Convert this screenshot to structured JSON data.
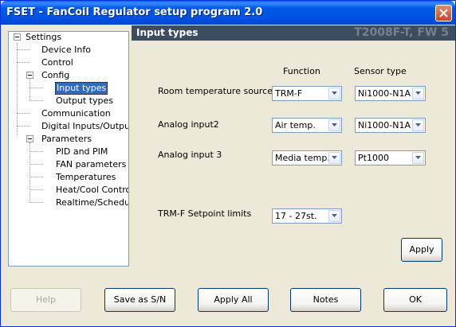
{
  "window": {
    "title": "FSET - FanCoil Regulator setup program 2.0"
  },
  "tree": {
    "items": [
      "Settings",
      "Device Info",
      "Control",
      "Config",
      "Input types",
      "Output types",
      "Communication",
      "Digital Inputs/Outputs",
      "Parameters",
      "PID and PIM",
      "FAN parameters",
      "Temperatures",
      "Heat/Cool Control",
      "Realtime/Schedule"
    ]
  },
  "panel": {
    "title": "Input types",
    "device": "T2008F-T, FW 5",
    "col_function": "Function",
    "col_sensor": "Sensor type",
    "rows": [
      {
        "label": "Room temperature source",
        "function": "TRM-F",
        "sensor": "Ni1000-N1A"
      },
      {
        "label": "Analog input2",
        "function": "Air temp.",
        "sensor": "Ni1000-N1A"
      },
      {
        "label": "Analog input 3",
        "function": "Media temp.",
        "sensor": "Pt1000"
      }
    ],
    "setpoint_label": "TRM-F Setpoint limits",
    "setpoint_value": "17 - 27st.",
    "apply_label": "Apply"
  },
  "footer": {
    "help": "Help",
    "save": "Save as S/N",
    "apply_all": "Apply All",
    "notes": "Notes",
    "ok": "OK"
  },
  "colors": {
    "titlebar": "#0058e6",
    "header": "#3d4c5f",
    "selection": "#316ac5"
  }
}
